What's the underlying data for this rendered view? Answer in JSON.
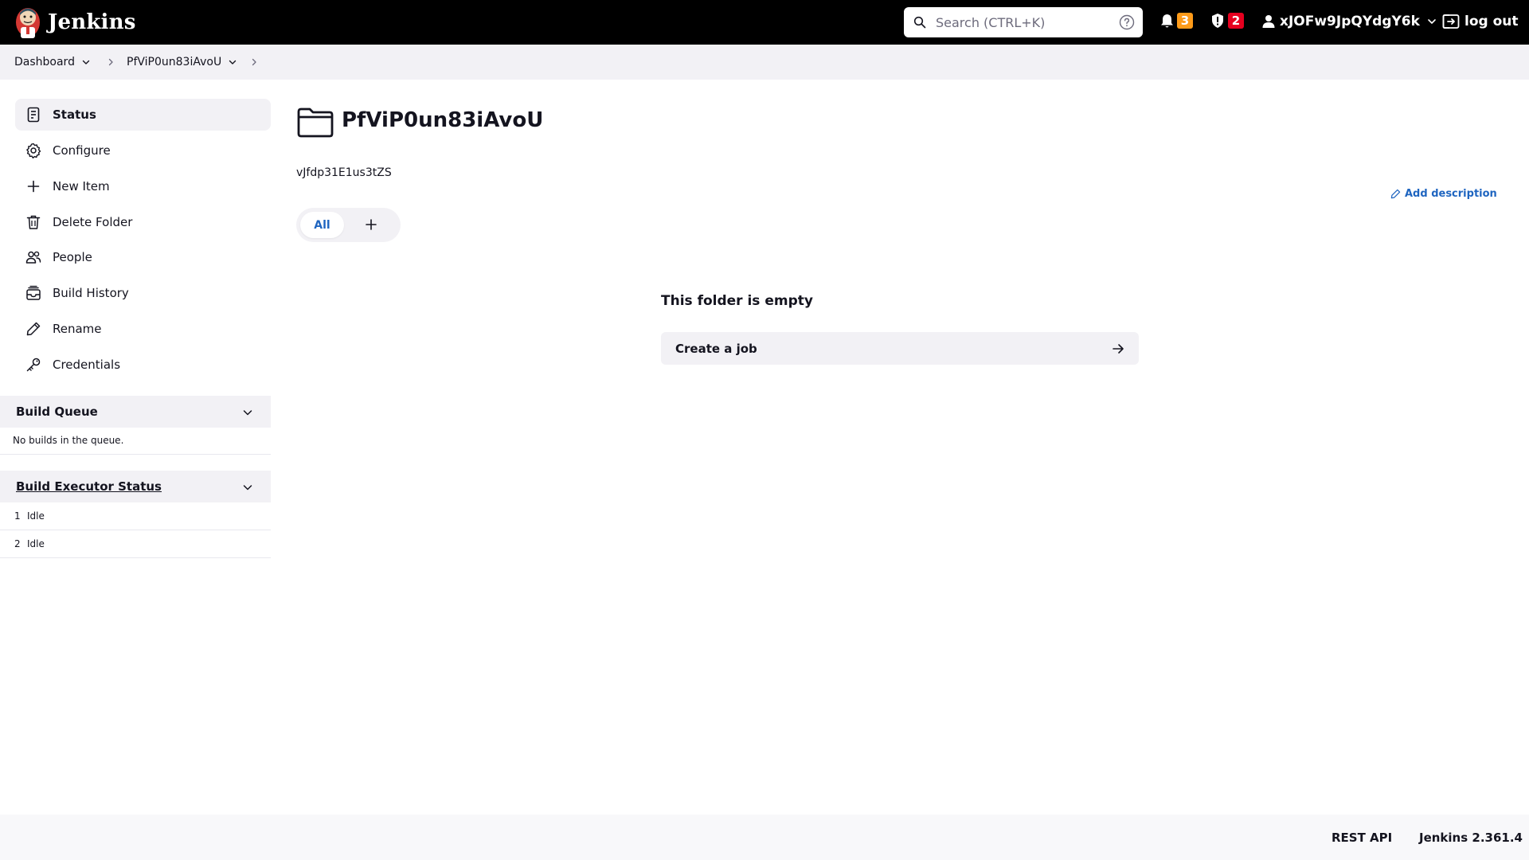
{
  "header": {
    "brand": "Jenkins",
    "search_placeholder": "Search (CTRL+K)",
    "notifications_count": "3",
    "security_count": "2",
    "username": "xJOFw9JpQYdgY6k",
    "logout_label": "log out"
  },
  "breadcrumb": {
    "items": [
      "Dashboard",
      "PfViP0un83iAvoU"
    ]
  },
  "sidebar": {
    "tasks": [
      {
        "label": "Status",
        "icon": "status-icon"
      },
      {
        "label": "Configure",
        "icon": "gear-icon"
      },
      {
        "label": "New Item",
        "icon": "plus-icon"
      },
      {
        "label": "Delete Folder",
        "icon": "trash-icon"
      },
      {
        "label": "People",
        "icon": "people-icon"
      },
      {
        "label": "Build History",
        "icon": "build-history-icon"
      },
      {
        "label": "Rename",
        "icon": "pencil-icon"
      },
      {
        "label": "Credentials",
        "icon": "key-icon"
      }
    ],
    "build_queue": {
      "title": "Build Queue",
      "empty_text": "No builds in the queue."
    },
    "executor_status": {
      "title": "Build Executor Status",
      "executors": [
        {
          "number": "1",
          "status": "Idle"
        },
        {
          "number": "2",
          "status": "Idle"
        }
      ]
    }
  },
  "main": {
    "title": "PfViP0un83iAvoU",
    "description": "vJfdp31E1us3tZS",
    "add_description_label": "Add description",
    "tabs": [
      "All"
    ],
    "empty_title": "This folder is empty",
    "create_job_label": "Create a job"
  },
  "footer": {
    "rest_api": "REST API",
    "version": "Jenkins 2.361.4"
  },
  "colors": {
    "header_bg": "#000000",
    "accent_link": "#1f65c0",
    "badge_orange": "#fe9b19",
    "badge_red": "#e6001f",
    "panel_bg": "#f2f1f5"
  }
}
